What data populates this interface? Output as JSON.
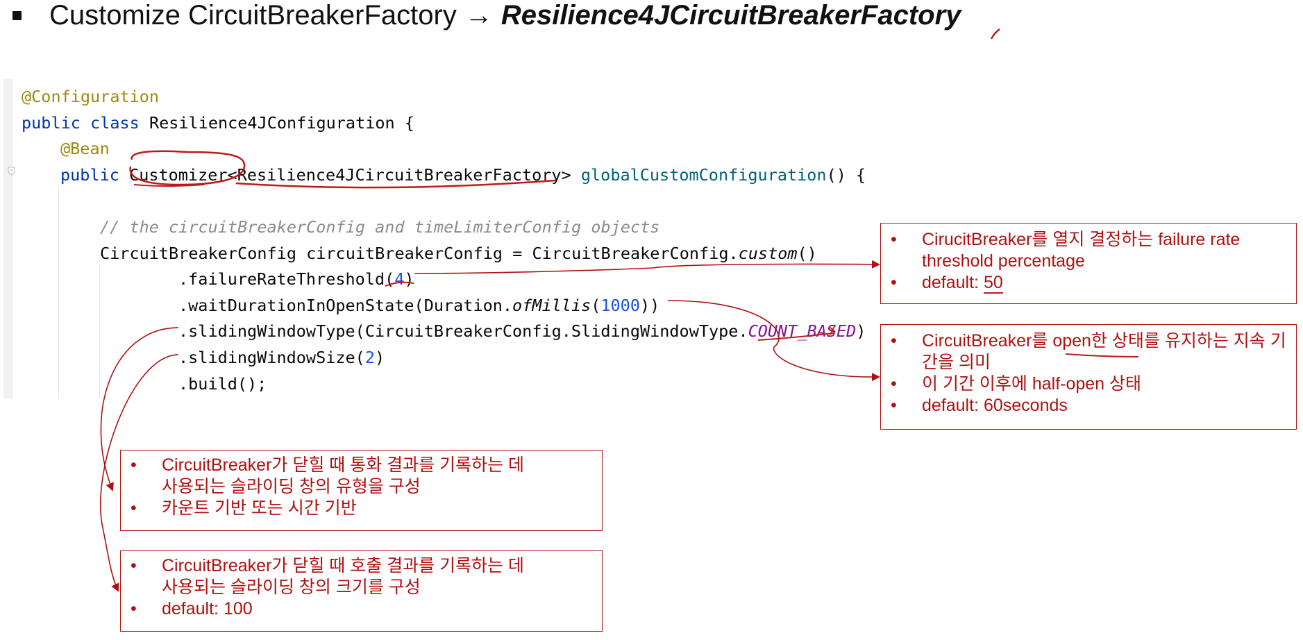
{
  "title": {
    "prefix": "Customize CircuitBreakerFactory",
    "arrow": "→",
    "emphasis": "Resilience4JCircuitBreakerFactory"
  },
  "code": {
    "annotation_config": "@Configuration",
    "kw_public": "public",
    "kw_class": "class",
    "class_name": "Resilience4JConfiguration {",
    "annotation_bean": "@Bean",
    "return_type": "Customizer<Resilience4JCircuitBreakerFactory>",
    "method_name": "globalCustomConfiguration",
    "method_tail": "() {",
    "comment": "// the circuitBreakerConfig and timeLimiterConfig objects",
    "config_decl": "CircuitBreakerConfig circuitBreakerConfig = CircuitBreakerConfig.",
    "custom_call": "custom",
    "custom_parens": "()",
    "failure_rate": ".failureRateThreshold(",
    "failure_rate_value": "4",
    "wait_duration": ".waitDurationInOpenState(Duration.",
    "of_millis": "ofMillis",
    "wait_duration_open": "(",
    "wait_duration_value": "1000",
    "wait_duration_close": "))",
    "sliding_type": ".slidingWindowType(CircuitBreakerConfig.SlidingWindowType.",
    "sliding_type_value": "COUNT_BASED",
    "sliding_size": ".slidingWindowSize(",
    "sliding_size_value": "2",
    "build": ".build();",
    "close_paren": ")"
  },
  "notes": {
    "failure_rate": [
      "CirucitBreaker를 열지 결정하는 failure rate threshold percentage",
      "default: ",
      "50"
    ],
    "wait_duration": [
      "CircuitBreaker를 open한 상태를 유지하는 지속 기간을 의미",
      "이 기간 이후에 half-open 상태",
      "default: 60seconds"
    ],
    "sliding_type": [
      "CircuitBreaker가 닫힐 때 통화 결과를 기록하는 데 사용되는 슬라이딩 창의 유형을 구성",
      "카운트 기반 또는 시간 기반"
    ],
    "sliding_size": [
      "CircuitBreaker가 닫힐 때 호출 결과를 기록하는 데 사용되는 슬라이딩 창의 크기를 구성",
      "default: 100"
    ]
  },
  "colors": {
    "annotation_red": "#b01010",
    "keyword": "#0033b3",
    "annotation": "#9e880d",
    "method": "#00627a",
    "number": "#1750eb",
    "comment": "#8c8c8c",
    "constant": "#871094"
  }
}
